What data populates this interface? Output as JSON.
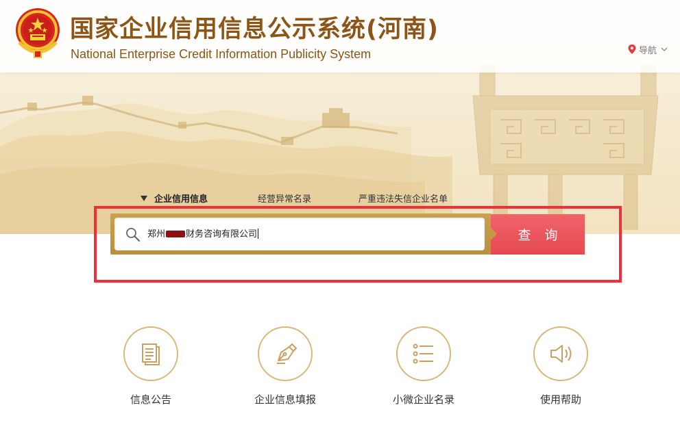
{
  "header": {
    "title_cn": "国家企业信用信息公示系统(河南)",
    "title_en": "National Enterprise Credit Information Publicity System",
    "nav_label": "导航"
  },
  "search": {
    "tabs": [
      {
        "label": "企业信用信息",
        "active": true
      },
      {
        "label": "经营异常名录",
        "active": false
      },
      {
        "label": "严重违法失信企业名单",
        "active": false
      }
    ],
    "value_prefix": "郑州",
    "value_suffix": "财务咨询有限公司",
    "button_label": "查询"
  },
  "features": [
    {
      "label": "信息公告",
      "icon": "document-icon"
    },
    {
      "label": "企业信息填报",
      "icon": "pen-icon"
    },
    {
      "label": "小微企业名录",
      "icon": "list-icon"
    },
    {
      "label": "使用帮助",
      "icon": "speaker-icon"
    }
  ],
  "colors": {
    "brand_brown": "#8c5416",
    "gold": "#c7a24f",
    "search_red": "#e54951",
    "annotation_red": "#f32e37"
  }
}
